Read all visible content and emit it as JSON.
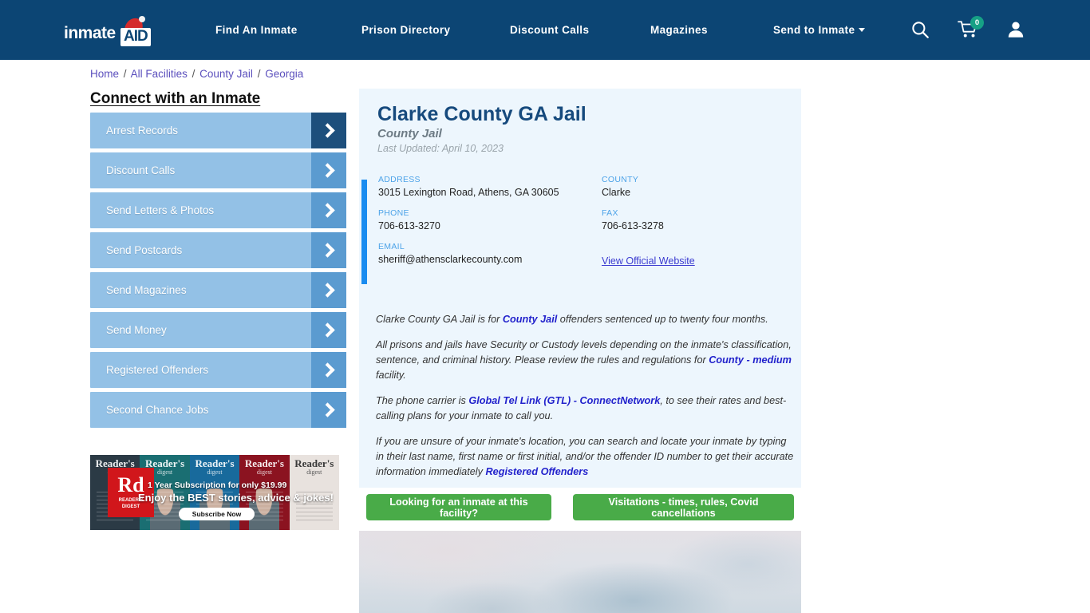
{
  "header": {
    "logo_text": "inmate",
    "logo_badge": "AID",
    "nav_items": [
      {
        "label": "Find An Inmate"
      },
      {
        "label": "Prison Directory"
      },
      {
        "label": "Discount Calls"
      },
      {
        "label": "Magazines"
      },
      {
        "label": "Send to Inmate"
      }
    ],
    "icons": {
      "search": "search-icon",
      "cart": "cart-icon",
      "user": "user-icon"
    },
    "cart_count": "0",
    "colors": {
      "header_bg": "#0c4574",
      "cart_badge": "#16a085"
    }
  },
  "breadcrumb": {
    "items": [
      "Home",
      "All Facilities",
      "County Jail",
      "Georgia"
    ],
    "separator": "/"
  },
  "sidebar": {
    "title": "Connect with an Inmate",
    "items": [
      {
        "label": "Arrest Records"
      },
      {
        "label": "Discount Calls"
      },
      {
        "label": "Send Letters & Photos"
      },
      {
        "label": "Send Postcards"
      },
      {
        "label": "Send Magazines"
      },
      {
        "label": "Send Money"
      },
      {
        "label": "Registered Offenders"
      },
      {
        "label": "Second Chance Jobs"
      }
    ]
  },
  "ad": {
    "brand_title": "Reader's",
    "brand_sub": "digest",
    "logo_big": "Rd",
    "logo_small_1": "READER'S",
    "logo_small_2": "DIGEST",
    "line1": "1 Year Subscription for only $19.99",
    "line2": "Enjoy the BEST stories, advice & jokes!",
    "button": "Subscribe Now"
  },
  "facility": {
    "name": "Clarke County GA Jail",
    "type": "County Jail",
    "last_updated": "Last Updated: April 10, 2023",
    "info": {
      "address_label": "ADDRESS",
      "address_value": "3015 Lexington Road, Athens, GA 30605",
      "phone_label": "PHONE",
      "phone_value": "706-613-3270",
      "email_label": "EMAIL",
      "email_value": "sheriff@athensclarkecounty.com",
      "county_label": "COUNTY",
      "county_value": "Clarke",
      "fax_label": "FAX",
      "fax_value": "706-613-3278",
      "website_link": "View Official Website"
    },
    "description": {
      "p1_a": "Clarke County GA Jail is for ",
      "p1_link": "County Jail",
      "p1_b": " offenders sentenced up to twenty four months.",
      "p2_a": "All prisons and jails have Security or Custody levels depending on the inmate's classification, sentence, and criminal history. Please review the rules and regulations for ",
      "p2_link": "County - medium",
      "p2_b": " facility.",
      "p3_a": "The phone carrier is ",
      "p3_link": "Global Tel Link (GTL) - ConnectNetwork",
      "p3_b": ", to see their rates and best-calling plans for your inmate to call you.",
      "p4_a": "If you are unsure of your inmate's location, you can search and locate your inmate by typing in their last name, first name or first initial, and/or the offender ID number to get their accurate information immediately ",
      "p4_link": "Registered Offenders"
    }
  },
  "actions": {
    "inmate_search": "Looking for an inmate at this facility?",
    "visitations": "Visitations - times, rules, Covid cancellations",
    "button_color": "#49ab48"
  },
  "photo": {
    "alt": "facility-sky-photo"
  }
}
